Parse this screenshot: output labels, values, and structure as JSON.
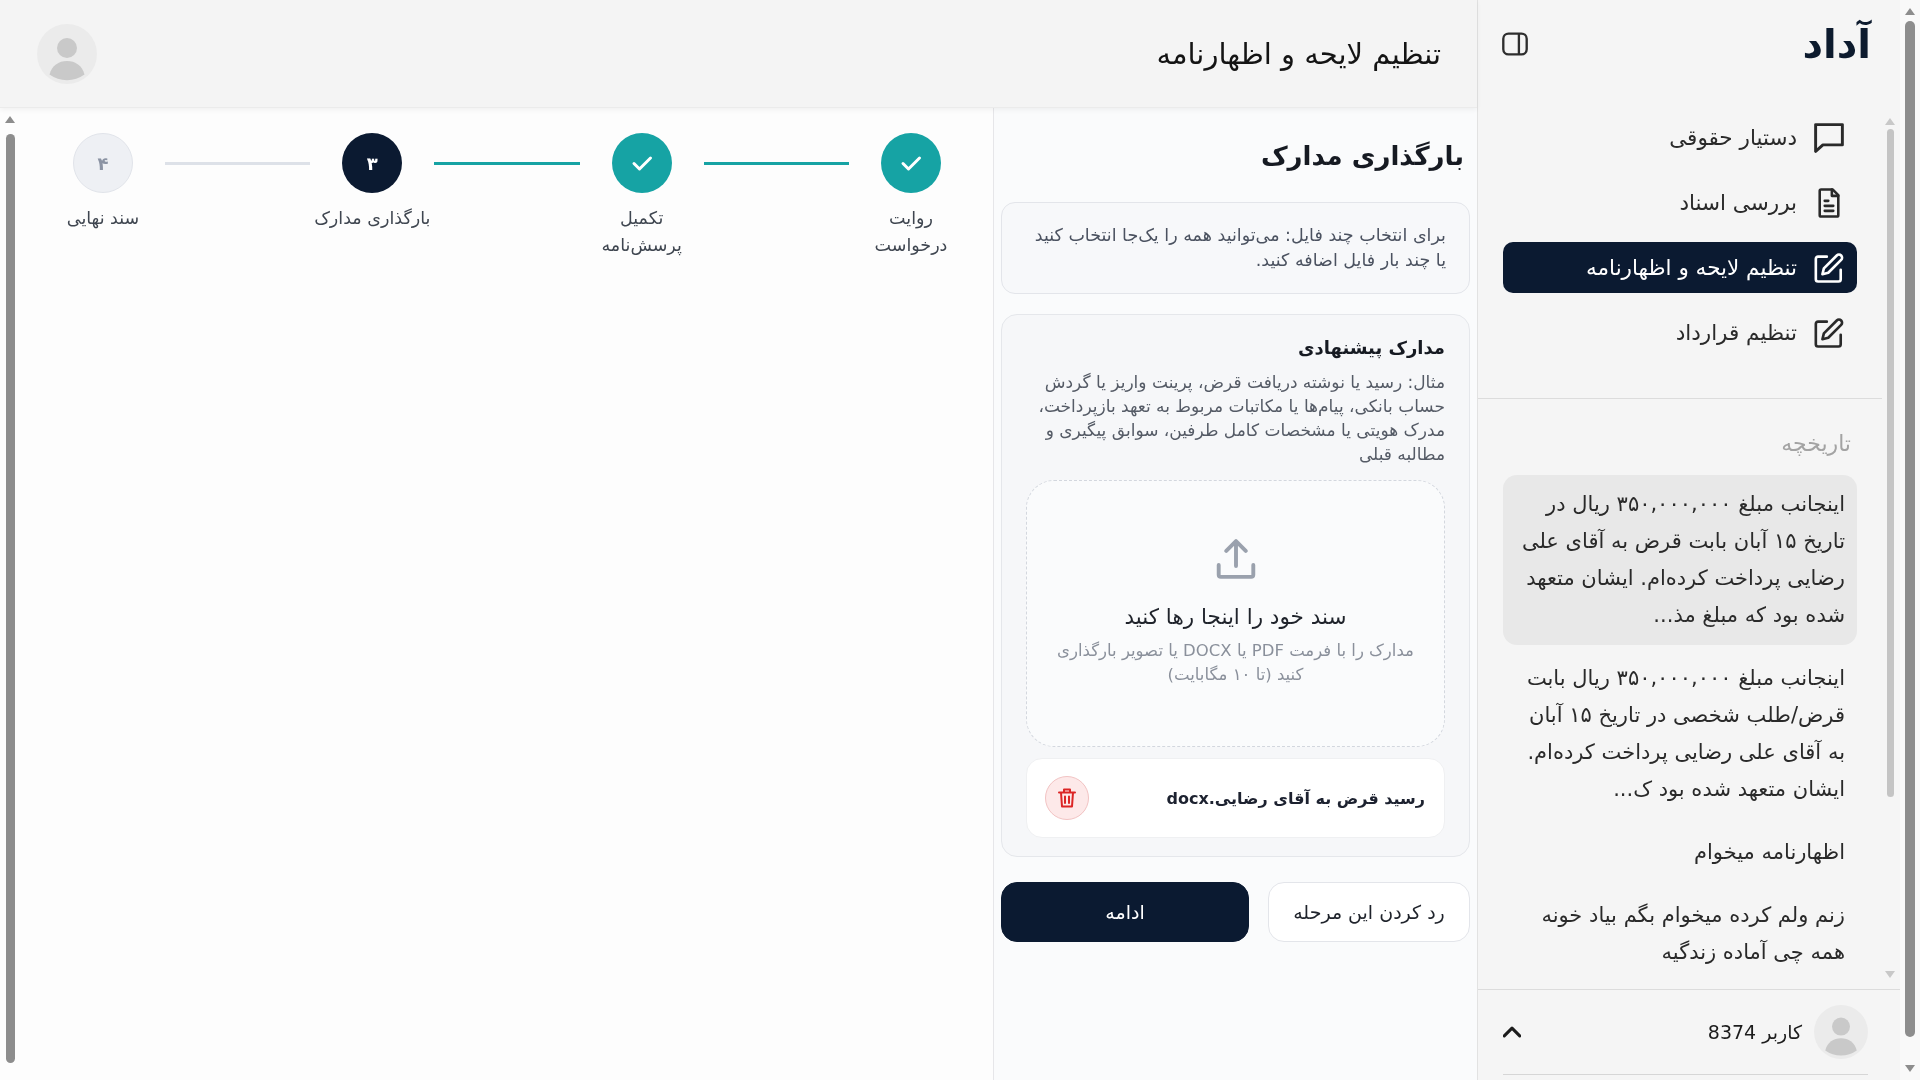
{
  "header": {
    "title": "تنظیم لایحه و اظهارنامه"
  },
  "stepper": {
    "steps": [
      {
        "label": "روایت\nدرخواست",
        "completed": true,
        "selected": false
      },
      {
        "label": "تکمیل\nپرسش‌نامه",
        "completed": true,
        "selected": false
      },
      {
        "label": "بارگذاری مدارک",
        "completed": false,
        "selected": true,
        "number": "۳"
      },
      {
        "label": "سند نهایی",
        "completed": false,
        "selected": false,
        "number": "۴"
      }
    ]
  },
  "upload_panel": {
    "title": "بارگذاری مدارک",
    "info": "برای انتخاب چند فایل: می‌توانید همه را یک‌جا انتخاب کنید یا چند بار فایل اضافه کنید.",
    "suggested": {
      "title": "مدارک پیشنهادی",
      "description": "مثال: رسید یا نوشته دریافت قرض، پرینت واریز یا گردش حساب بانکی، پیام‌ها یا مکاتبات مربوط به تعهد بازپرداخت، مدرک هویتی یا مشخصات کامل طرفین، سوابق پیگیری و مطالبه قبلی"
    },
    "dropzone": {
      "title": "سند خود را اینجا رها کنید",
      "hint": "مدارک را با فرمت PDF یا DOCX یا تصویر بارگذاری کنید (تا ۱۰ مگابایت)"
    },
    "files": [
      {
        "name": "رسید قرض به آقای رضایی.docx"
      }
    ],
    "buttons": [
      {
        "label": "رد کردن این مرحله",
        "kind": "secondary"
      },
      {
        "label": "ادامه",
        "kind": "primary"
      }
    ]
  },
  "sidebar": {
    "logo": "آداد",
    "nav_items": [
      {
        "label": "دستیار حقوقی",
        "selected": false
      },
      {
        "label": "بررسی اسناد",
        "selected": false
      },
      {
        "label": "تنظیم لایحه و اظهارنامه",
        "selected": true
      },
      {
        "label": "تنظیم قرارداد",
        "selected": false
      }
    ],
    "history": {
      "heading": "تاریخچه",
      "items": [
        {
          "text": "اینجانب مبلغ ۳۵۰,۰۰۰,۰۰۰ ریال در تاریخ ۱۵ آبان بابت قرض به آقای علی رضایی پرداخت کرده‌ام. ایشان متعهد شده بود که مبلغ مذ...",
          "selected": true
        },
        {
          "text": "اینجانب مبلغ ۳۵۰,۰۰۰,۰۰۰ ریال بابت قرض/طلب شخصی در تاریخ ۱۵ آبان به آقای علی رضایی پرداخت کرده‌ام. ایشان متعهد شده بود ک...",
          "selected": false
        },
        {
          "text": "اظهارنامه میخوام",
          "selected": false
        },
        {
          "text": "زنم ولم کرده میخوام بگم بیاد خونه همه چی آماده زندگیه",
          "selected": false
        }
      ]
    },
    "user": {
      "name": "کاربر 8374"
    }
  }
}
